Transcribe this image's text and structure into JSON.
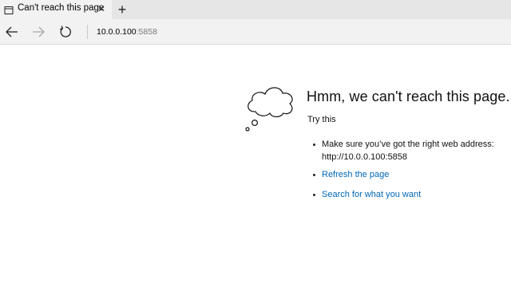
{
  "tab": {
    "title": "Can't reach this page",
    "page_icon": "page-icon",
    "close_icon": "close-icon",
    "new_tab_icon": "plus-icon"
  },
  "toolbar": {
    "back_icon": "arrow-left-icon",
    "forward_icon": "arrow-right-icon",
    "refresh_icon": "refresh-icon",
    "address_host": "10.0.0.100",
    "address_port": ":5858"
  },
  "error": {
    "illustration": "thought-cloud-icon",
    "heading": "Hmm, we can't reach this page.",
    "try_this": "Try this",
    "tip_1_line1": "Make sure you’ve got the right web address:",
    "tip_1_line2": "http://10.0.0.100:5858",
    "tip_2": "Refresh the page",
    "tip_3": "Search for what you want"
  },
  "colors": {
    "link": "#0067b8",
    "tab_active": "#f2f2f2",
    "tabstrip": "#e6e6e6"
  }
}
